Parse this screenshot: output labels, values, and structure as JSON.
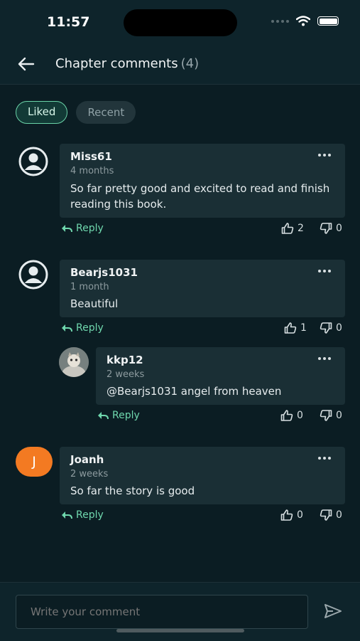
{
  "status_bar": {
    "time": "11:57"
  },
  "header": {
    "title": "Chapter comments",
    "count": "(4)"
  },
  "filters": [
    {
      "label": "Liked",
      "active": true
    },
    {
      "label": "Recent",
      "active": false
    }
  ],
  "comments": [
    {
      "username": "Miss61",
      "time": "4 months",
      "text": "So far pretty good and excited to read and finish reading this book.",
      "reply_label": "Reply",
      "likes": "2",
      "dislikes": "0",
      "avatar": "person-icon"
    },
    {
      "username": "Bearjs1031",
      "time": "1 month",
      "text": "Beautiful",
      "reply_label": "Reply",
      "likes": "1",
      "dislikes": "0",
      "avatar": "person-icon"
    },
    {
      "username": "kkp12",
      "time": "2 weeks",
      "text": "@Bearjs1031 angel from heaven",
      "reply_label": "Reply",
      "likes": "0",
      "dislikes": "0",
      "avatar": "photo"
    },
    {
      "username": "Joanh",
      "time": "2 weeks",
      "text": "So far the story is good",
      "reply_label": "Reply",
      "likes": "0",
      "dislikes": "0",
      "avatar_letter": "J"
    }
  ],
  "composer": {
    "placeholder": "Write your comment"
  },
  "colors": {
    "background": "#0b1d23",
    "accent": "#6fd7ad",
    "avatar_orange": "#f37a22"
  }
}
